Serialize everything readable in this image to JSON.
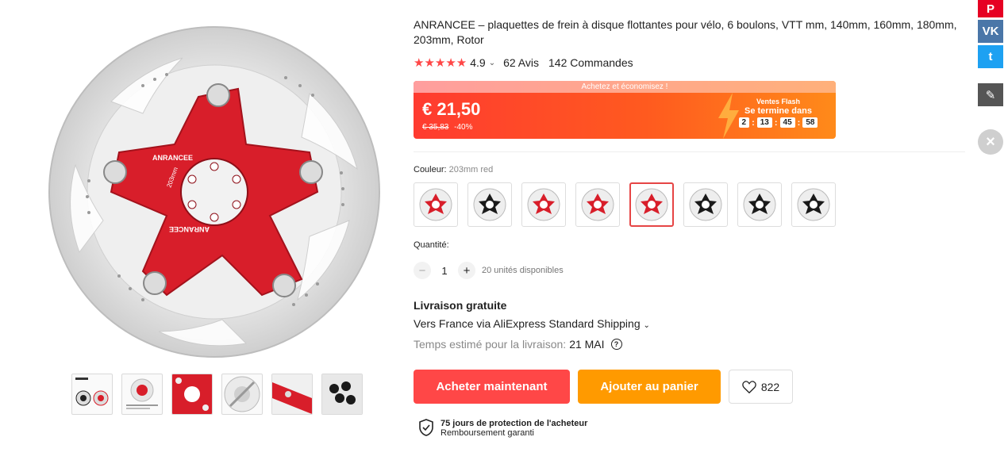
{
  "product": {
    "title": "ANRANCEE – plaquettes de frein à disque flottantes pour vélo, 6 boulons, VTT mm, 140mm, 160mm, 180mm, 203mm, Rotor",
    "stars": "★★★★★",
    "rating": "4.9",
    "reviews": "62 Avis",
    "orders": "142 Commandes"
  },
  "price": {
    "banner": "Achetez et économisez !",
    "current": "€ 21,50",
    "original": "€ 35,83",
    "discount": "-40%",
    "flash_title": "Ventes Flash",
    "flash_ends": "Se termine dans",
    "timer": [
      "2",
      "13",
      "45",
      "58"
    ]
  },
  "color": {
    "label": "Couleur:",
    "value": "203mm red",
    "selected_index": 4
  },
  "quantity": {
    "label": "Quantité:",
    "minus": "−",
    "plus": "+",
    "value": "1",
    "available": "20 unités disponibles"
  },
  "shipping": {
    "title": "Livraison gratuite",
    "line": "Vers France via AliExpress Standard Shipping",
    "estimate_label": "Temps estimé pour la livraison:",
    "estimate_date": "21 MAI"
  },
  "actions": {
    "buy": "Acheter maintenant",
    "cart": "Ajouter au panier",
    "wishlist_count": "822"
  },
  "protection": {
    "title": "75 jours de protection de l'acheteur",
    "subtitle": "Remboursement garanti"
  },
  "image": {
    "brand_mark": "ANRANCEE",
    "size_mark": "203mm"
  },
  "social": {
    "pinterest": "P",
    "vk": "VK",
    "twitter": "t"
  },
  "colors": {
    "accent": "#ff4747",
    "cart": "#ff9a00",
    "rotor_red": "#d81e2a"
  }
}
